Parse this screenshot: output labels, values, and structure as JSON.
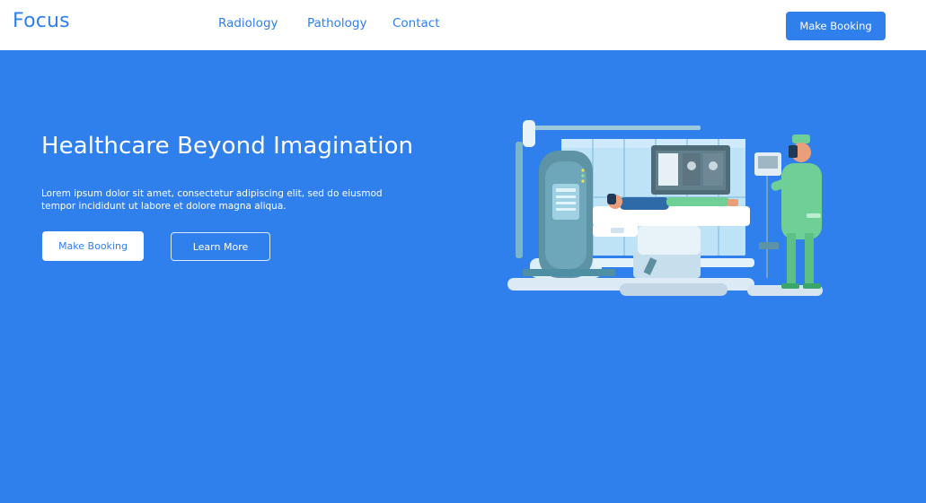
{
  "header": {
    "brand": "Focus",
    "nav": [
      "Radiology",
      "Pathology",
      "Contact"
    ],
    "cta_label": "Make Booking"
  },
  "hero": {
    "title": "Healthcare Beyond Imagination",
    "subtitle": "Lorem ipsum dolor sit amet, consectetur adipiscing elit, sed do eiusmod tempor incididunt ut labore et dolore magna aliqua.",
    "primary_button": "Make Booking",
    "secondary_button": "Learn More"
  },
  "illustration": {
    "subject": "medical-scan-room"
  },
  "colors": {
    "brand_blue": "#2f80ed",
    "white": "#ffffff",
    "scrub_green": "#6fcf97",
    "machine_teal": "#4f8fa3"
  }
}
